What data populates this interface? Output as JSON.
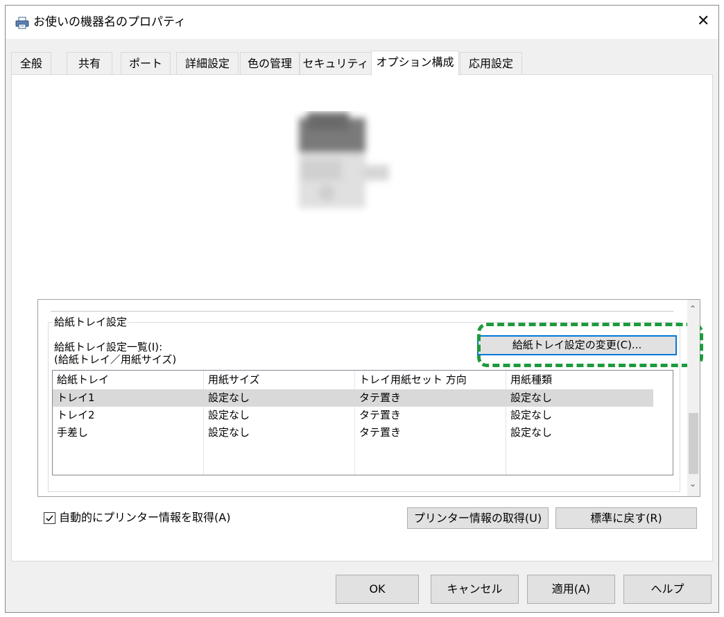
{
  "window": {
    "title": "お使いの機器名のプロパティ",
    "close_label": "✕"
  },
  "tabs": [
    {
      "label": "全般"
    },
    {
      "label": "共有"
    },
    {
      "label": "ポート"
    },
    {
      "label": "詳細設定"
    },
    {
      "label": "色の管理"
    },
    {
      "label": "セキュリティ"
    },
    {
      "label": "オプション構成",
      "active": true
    },
    {
      "label": "応用設定"
    }
  ],
  "tray_group": {
    "label": "給紙トレイ設定",
    "list_caption_line1": "給紙トレイ設定一覧(I):",
    "list_caption_line2": "(給紙トレイ／用紙サイズ)",
    "change_button": "給紙トレイ設定の変更(C)...",
    "columns": [
      "給紙トレイ",
      "用紙サイズ",
      "トレイ用紙セット 方向",
      "用紙種類"
    ],
    "rows": [
      {
        "tray": "トレイ1",
        "size": "設定なし",
        "direction": "タテ置き",
        "type": "設定なし",
        "selected": true
      },
      {
        "tray": "トレイ2",
        "size": "設定なし",
        "direction": "タテ置き",
        "type": "設定なし"
      },
      {
        "tray": "手差し",
        "size": "設定なし",
        "direction": "タテ置き",
        "type": "設定なし"
      }
    ]
  },
  "auto_get": {
    "label": "自動的にプリンター情報を取得(A)",
    "checked": true
  },
  "buttons": {
    "get_info": "プリンター情報の取得(U)",
    "reset": "標準に戻す(R)",
    "ok": "OK",
    "cancel": "キャンセル",
    "apply": "適用(A)",
    "help": "ヘルプ"
  },
  "colors": {
    "highlight": "#1e9a3d",
    "focus": "#0078d7",
    "selected_row": "#d9d9d9"
  }
}
